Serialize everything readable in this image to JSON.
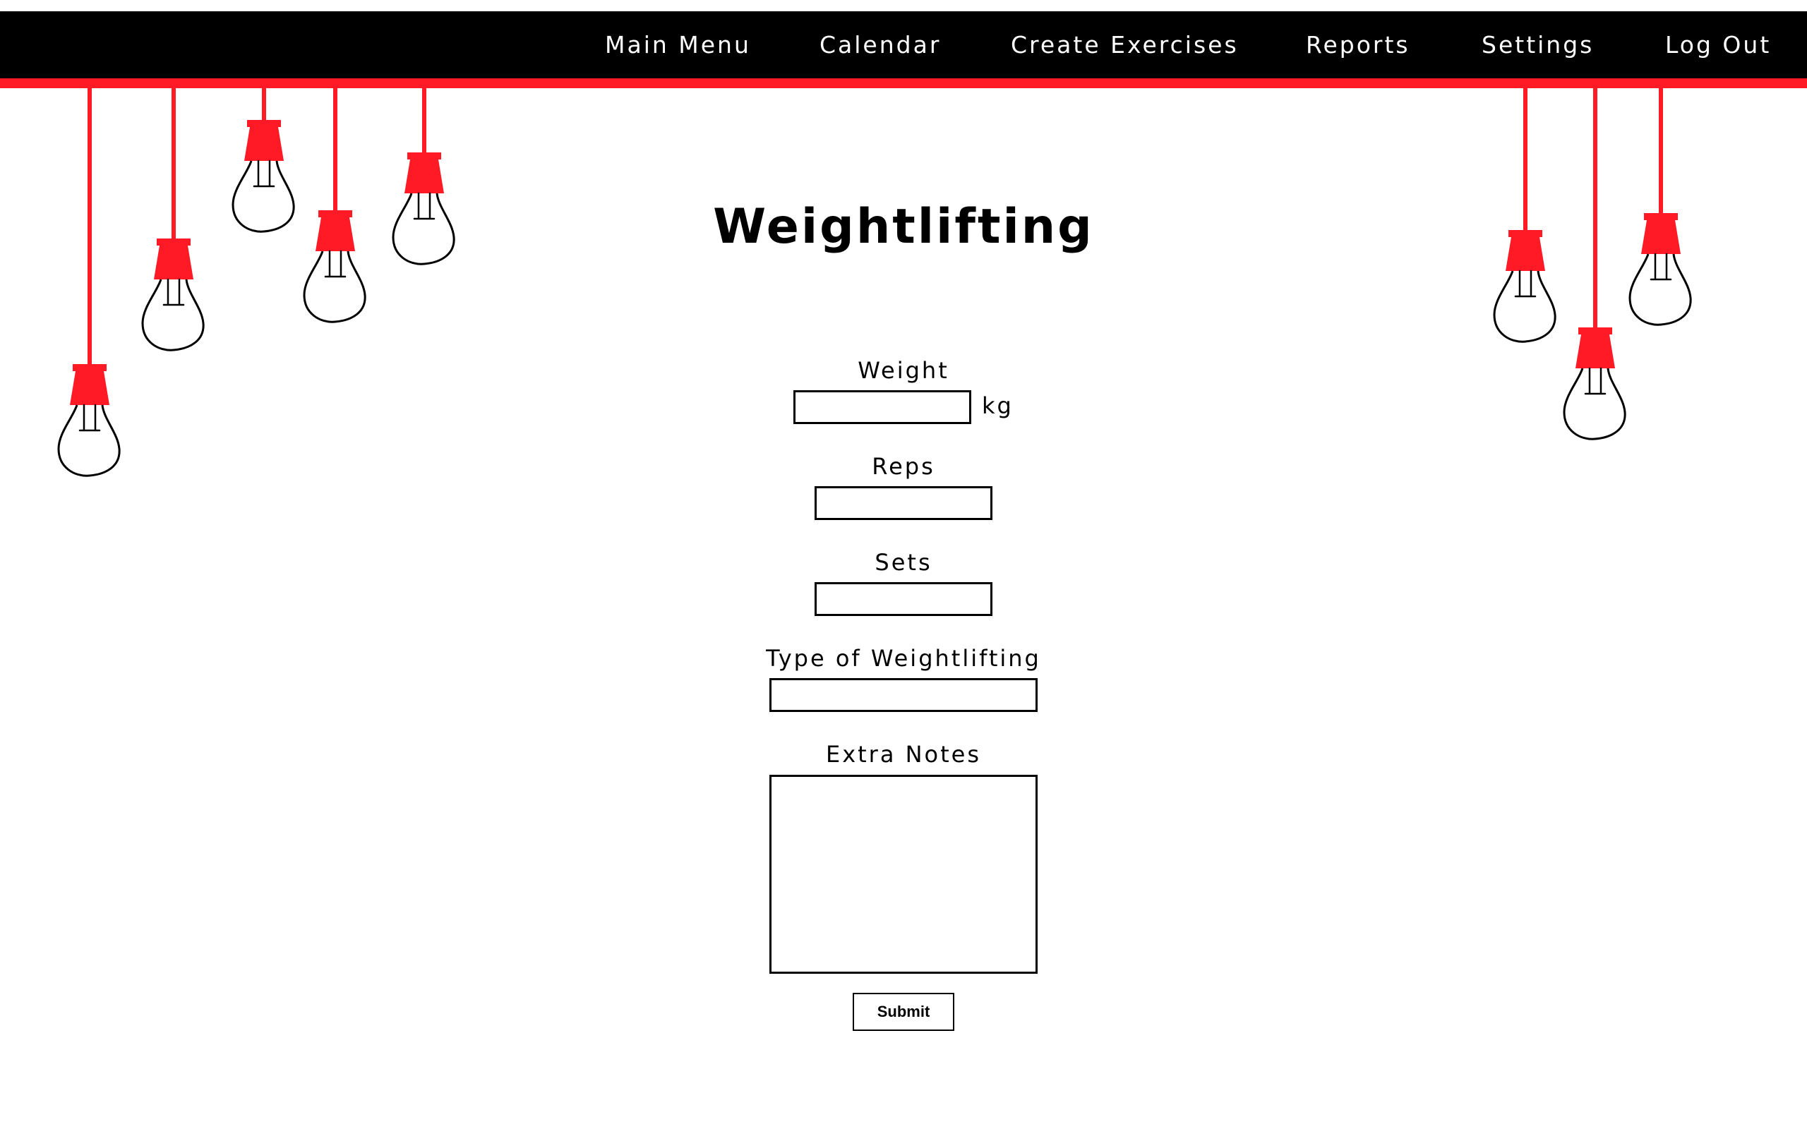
{
  "nav": {
    "items": [
      {
        "label": "Main Menu"
      },
      {
        "label": "Calendar"
      },
      {
        "label": "Create Exercises"
      },
      {
        "label": "Reports"
      },
      {
        "label": "Settings"
      },
      {
        "label": "Log Out"
      }
    ]
  },
  "main": {
    "title": "Weightlifting"
  },
  "form": {
    "weight_label": "Weight",
    "weight_unit": "kg",
    "weight_value": "",
    "reps_label": "Reps",
    "reps_value": "",
    "sets_label": "Sets",
    "sets_value": "",
    "type_label": "Type of Weightlifting",
    "type_value": "",
    "notes_label": "Extra Notes",
    "notes_value": "",
    "submit_label": "Submit"
  },
  "decor": {
    "icon": "hanging-light-bulb-icon",
    "accent_color": "#ff1a26",
    "nav_background": "#000000",
    "page_background": "#ffffff"
  }
}
